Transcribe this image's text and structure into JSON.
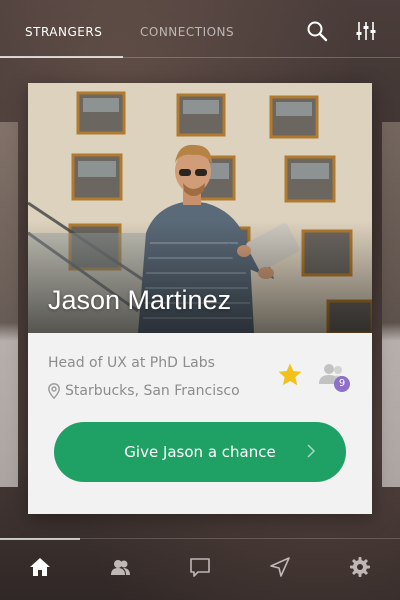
{
  "tabs": [
    {
      "label": "STRANGERS",
      "active": true
    },
    {
      "label": "CONNECTIONS",
      "active": false
    }
  ],
  "header_icons": [
    "search-icon",
    "filter-sliders-icon"
  ],
  "profile": {
    "name": "Jason Martinez",
    "job": "Head of UX at PhD Labs",
    "location": "Starbucks, San Francisco",
    "mutual_count": "9",
    "favorited": true
  },
  "cta": {
    "label": "Give Jason a chance"
  },
  "bottom_nav": [
    "home-icon",
    "people-icon",
    "chat-icon",
    "navigate-icon",
    "settings-icon"
  ],
  "colors": {
    "accent": "#1fa065",
    "star": "#f2c21b",
    "badge": "#8e6fc9",
    "card": "#f2f2f2"
  }
}
